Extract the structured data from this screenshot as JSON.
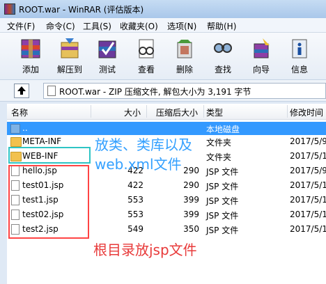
{
  "window": {
    "title": "ROOT.war - WinRAR (评估版本)"
  },
  "menu": [
    "文件(F)",
    "命令(C)",
    "工具(S)",
    "收藏夹(O)",
    "选项(N)",
    "帮助(H)"
  ],
  "toolbar": [
    {
      "label": "添加",
      "icon": "add-archive-icon"
    },
    {
      "label": "解压到",
      "icon": "extract-to-icon"
    },
    {
      "label": "测试",
      "icon": "test-icon"
    },
    {
      "label": "查看",
      "icon": "view-icon"
    },
    {
      "label": "删除",
      "icon": "delete-icon"
    },
    {
      "label": "查找",
      "icon": "find-icon"
    },
    {
      "label": "向导",
      "icon": "wizard-icon"
    },
    {
      "label": "信息",
      "icon": "info-icon"
    }
  ],
  "address": {
    "text": "ROOT.war - ZIP 压缩文件, 解包大小为 3,191 字节"
  },
  "columns": {
    "name": "名称",
    "size": "大小",
    "packed": "压缩后大小",
    "type": "类型",
    "modified": "修改时间"
  },
  "rows": [
    {
      "name": "..",
      "size": "",
      "packed": "",
      "type": "本地磁盘",
      "modified": "",
      "kind": "up"
    },
    {
      "name": "META-INF",
      "size": "",
      "packed": "",
      "type": "文件夹",
      "modified": "2017/5/9",
      "kind": "folder"
    },
    {
      "name": "WEB-INF",
      "size": "",
      "packed": "",
      "type": "文件夹",
      "modified": "2017/5/1",
      "kind": "folder"
    },
    {
      "name": "hello.jsp",
      "size": "422",
      "packed": "290",
      "type": "JSP 文件",
      "modified": "2017/5/9",
      "kind": "file"
    },
    {
      "name": "test01.jsp",
      "size": "422",
      "packed": "290",
      "type": "JSP 文件",
      "modified": "2017/5/1",
      "kind": "file"
    },
    {
      "name": "test1.jsp",
      "size": "553",
      "packed": "399",
      "type": "JSP 文件",
      "modified": "2017/5/1",
      "kind": "file"
    },
    {
      "name": "test02.jsp",
      "size": "553",
      "packed": "399",
      "type": "JSP 文件",
      "modified": "2017/5/1",
      "kind": "file"
    },
    {
      "name": "test2.jsp",
      "size": "549",
      "packed": "350",
      "type": "JSP 文件",
      "modified": "2017/5/1",
      "kind": "file"
    }
  ],
  "annotations": {
    "blue_line1": "放类、类库以及",
    "blue_line2": "web.xml文件",
    "red": "根目录放jsp文件"
  }
}
